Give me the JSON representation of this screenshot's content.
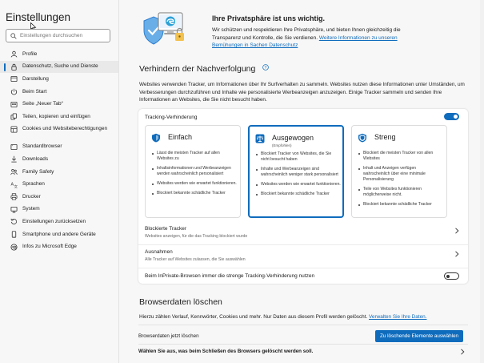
{
  "sidebar": {
    "title": "Einstellungen",
    "search_placeholder": "Einstellungen durchsuchen",
    "items": [
      {
        "label": "Profile",
        "icon": "profile-icon"
      },
      {
        "label": "Datenschutz, Suche und Dienste",
        "icon": "lock-icon",
        "active": true
      },
      {
        "label": "Darstellung",
        "icon": "appearance-icon"
      },
      {
        "label": "Beim Start",
        "icon": "power-icon"
      },
      {
        "label": "Seite „Neuer Tab“",
        "icon": "new-tab-icon"
      },
      {
        "label": "Teilen, kopieren und einfügen",
        "icon": "share-icon"
      },
      {
        "label": "Cookies und Websiteberechtigungen",
        "icon": "cookies-icon"
      },
      {
        "label": "Standardbrowser",
        "icon": "browser-icon"
      },
      {
        "label": "Downloads",
        "icon": "download-icon"
      },
      {
        "label": "Family Safety",
        "icon": "family-icon"
      },
      {
        "label": "Sprachen",
        "icon": "language-icon"
      },
      {
        "label": "Drucker",
        "icon": "printer-icon"
      },
      {
        "label": "System",
        "icon": "system-icon"
      },
      {
        "label": "Einstellungen zurücksetzen",
        "icon": "reset-icon"
      },
      {
        "label": "Smartphone und andere Geräte",
        "icon": "phone-icon"
      },
      {
        "label": "Infos zu Microsoft Edge",
        "icon": "edge-icon"
      }
    ]
  },
  "hero": {
    "title": "Ihre Privatsphäre ist uns wichtig.",
    "text": "Wir schützen und respektieren Ihre Privatsphäre, und bieten Ihnen gleichzeitig die Transparenz und Kontrolle, die Sie verdienen. ",
    "link": "Weitere Informationen zu unseren Bemühungen in Sachen Datenschutz"
  },
  "tracking": {
    "section_title": "Verhindern der Nachverfolgung",
    "description": "Websites verwenden Tracker, um Informationen über Ihr Surfverhalten zu sammeln. Websites nutzen diese Informationen unter Umständen, um Verbesserungen durchzuführen und Inhalte wie personalisierte Werbeanzeigen anzuzeigen. Einige Tracker sammeln und senden Ihre Informationen an Websites, die Sie nicht besucht haben.",
    "panel_title": "Tracking-Verhinderung",
    "enabled": true,
    "cards": [
      {
        "title": "Einfach",
        "subtitle": "",
        "icon": "basic-shield-icon",
        "selected": false,
        "points": [
          "Lässt die meisten Tracker auf allen Websites zu",
          "Inhaltsinformationen und Werbeanzeigen werden wahrscheinlich personalisiert",
          "Websites werden wie erwartet funktionieren.",
          "Blockiert bekannte schädliche Tracker"
        ]
      },
      {
        "title": "Ausgewogen",
        "subtitle": "(Empfohlen)",
        "icon": "balanced-scale-icon",
        "selected": true,
        "points": [
          "Blockiert Tracker von Websites, die Sie nicht besucht haben",
          "Inhalte und Werbeanzeigen sind wahrscheinlich weniger stark personalisiert",
          "Websites werden wie erwartet funktionieren.",
          "Blockiert bekannte schädliche Tracker"
        ]
      },
      {
        "title": "Streng",
        "subtitle": "",
        "icon": "strict-shield-icon",
        "selected": false,
        "points": [
          "Blockiert die meisten Tracker von allen Websites",
          "Inhalt und Anzeigen verfügen wahrscheinlich über eine minimale Personalisierung",
          "Teile von Websites funktionieren möglicherweise nicht.",
          "Blockiert bekannte schädliche Tracker"
        ]
      }
    ],
    "rows": {
      "blocked_title": "Blockierte Tracker",
      "blocked_sub": "Websites anzeigen, für die das Tracking blockiert wurde",
      "exceptions_title": "Ausnahmen",
      "exceptions_sub": "Alle Tracker auf Websites zulassen, die Sie auswählen",
      "inprivate_label": "Beim InPrivate-Browsen immer die strenge Tracking-Verhinderung nutzen",
      "inprivate_enabled": false
    }
  },
  "browsing_data": {
    "section_title": "Browserdaten löschen",
    "description": "Hierzu zählen Verlauf, Kennwörter, Cookies und mehr. Nur Daten aus diesem Profil werden gelöscht. ",
    "link": "Verwalten Sie Ihre Daten.",
    "clear_now_label": "Browserdaten jetzt löschen",
    "clear_button": "Zu löschende Elemente auswählen",
    "on_close_label": "Wählen Sie aus, was beim Schließen des Browsers gelöscht werden soll."
  },
  "colors": {
    "accent": "#0f6cbd",
    "sidebar_bg": "#f7f7f7",
    "panel_bg": "#ffffff"
  }
}
